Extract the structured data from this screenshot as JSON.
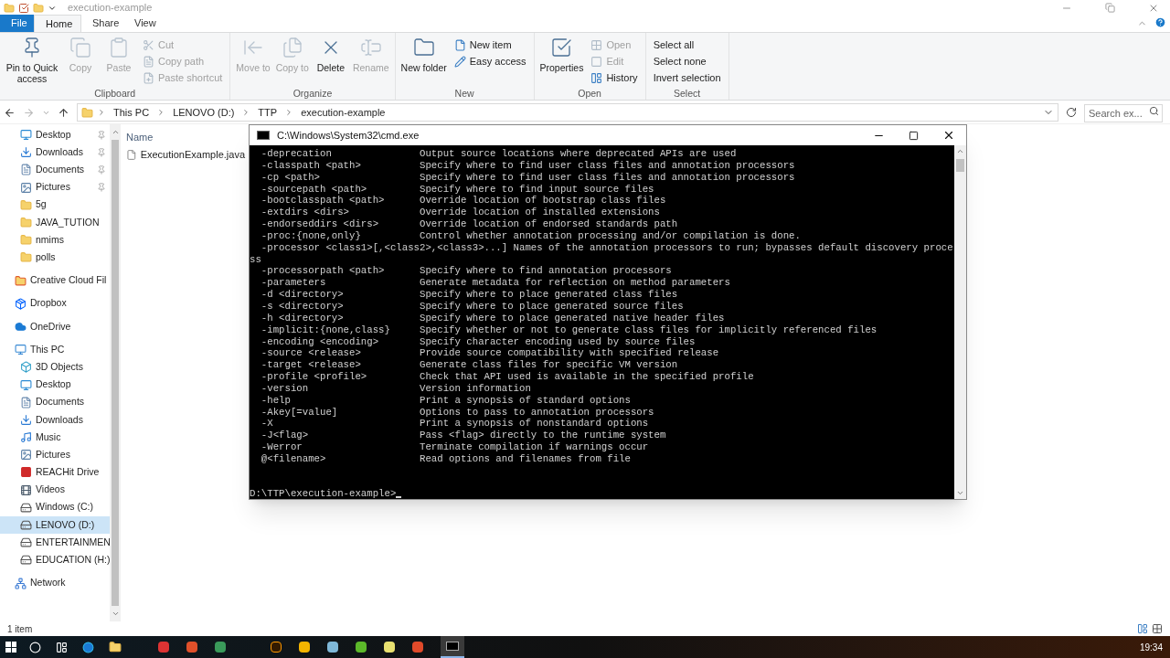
{
  "explorer": {
    "title": "execution-example",
    "tabs": [
      {
        "label": "File",
        "selected": false,
        "kind": "file"
      },
      {
        "label": "Home",
        "selected": true,
        "kind": "tab"
      },
      {
        "label": "Share",
        "selected": false,
        "kind": "tab"
      },
      {
        "label": "View",
        "selected": false,
        "kind": "tab"
      }
    ],
    "ribbon_groups": [
      {
        "label": "Clipboard",
        "items": [
          {
            "label": "Pin to Quick access",
            "kind": "large",
            "disabled": false
          },
          {
            "label": "Copy",
            "kind": "large",
            "disabled": true
          },
          {
            "label": "Paste",
            "kind": "large",
            "disabled": true
          },
          {
            "kind": "stack",
            "items": [
              {
                "label": "Cut",
                "disabled": true
              },
              {
                "label": "Copy path",
                "disabled": true
              },
              {
                "label": "Paste shortcut",
                "disabled": true
              }
            ]
          }
        ]
      },
      {
        "label": "Organize",
        "items": [
          {
            "label": "Move to",
            "kind": "large",
            "disabled": true
          },
          {
            "label": "Copy to",
            "kind": "large",
            "disabled": true
          },
          {
            "label": "Delete",
            "kind": "large",
            "disabled": false
          },
          {
            "label": "Rename",
            "kind": "large",
            "disabled": true
          }
        ]
      },
      {
        "label": "New",
        "items": [
          {
            "label": "New folder",
            "kind": "large",
            "disabled": false
          },
          {
            "kind": "stack",
            "items": [
              {
                "label": "New item",
                "disabled": false
              },
              {
                "label": "Easy access",
                "disabled": false
              }
            ]
          }
        ]
      },
      {
        "label": "Open",
        "items": [
          {
            "label": "Properties",
            "kind": "large",
            "disabled": false
          },
          {
            "kind": "stack",
            "items": [
              {
                "label": "Open",
                "disabled": true
              },
              {
                "label": "Edit",
                "disabled": true
              },
              {
                "label": "History",
                "disabled": false
              }
            ]
          }
        ]
      },
      {
        "label": "Select",
        "items": [
          {
            "kind": "stack",
            "items": [
              {
                "label": "Select all",
                "disabled": false
              },
              {
                "label": "Select none",
                "disabled": false
              },
              {
                "label": "Invert selection",
                "disabled": false
              }
            ]
          }
        ]
      }
    ],
    "breadcrumbs": [
      "This PC",
      "LENOVO (D:)",
      "TTP",
      "execution-example"
    ],
    "search": {
      "placeholder": "Search ex..."
    },
    "quick_access": [
      {
        "label": "Desktop",
        "kind": "desktop",
        "pinned": true,
        "selected": false
      },
      {
        "label": "Downloads",
        "kind": "download",
        "pinned": true,
        "selected": false
      },
      {
        "label": "Documents",
        "kind": "document",
        "pinned": true,
        "selected": false
      },
      {
        "label": "Pictures",
        "kind": "pictures",
        "pinned": true,
        "selected": false
      },
      {
        "label": "5g",
        "kind": "folder",
        "pinned": false,
        "selected": false
      },
      {
        "label": "JAVA_TUTION",
        "kind": "folder",
        "pinned": false,
        "selected": false
      },
      {
        "label": "nmims",
        "kind": "folder",
        "pinned": false,
        "selected": false
      },
      {
        "label": "polls",
        "kind": "folder",
        "pinned": false,
        "selected": false
      }
    ],
    "nav": [
      {
        "label": "Creative Cloud Fil",
        "kind": "creative",
        "selected": false
      },
      {
        "label": "Dropbox",
        "kind": "dropbox",
        "selected": false
      },
      {
        "label": "OneDrive",
        "kind": "cloud",
        "selected": false
      },
      {
        "label": "This PC",
        "kind": "pc",
        "selected": false,
        "children": [
          {
            "label": "3D Objects",
            "kind": "cube",
            "selected": false
          },
          {
            "label": "Desktop",
            "kind": "desktop",
            "selected": false
          },
          {
            "label": "Documents",
            "kind": "document",
            "selected": false
          },
          {
            "label": "Downloads",
            "kind": "download",
            "selected": false
          },
          {
            "label": "Music",
            "kind": "music",
            "selected": false
          },
          {
            "label": "Pictures",
            "kind": "pictures",
            "selected": false
          },
          {
            "label": "REACHit Drive",
            "kind": "reachit",
            "selected": false
          },
          {
            "label": "Videos",
            "kind": "video",
            "selected": false
          },
          {
            "label": "Windows (C:)",
            "kind": "drive",
            "selected": false
          },
          {
            "label": "LENOVO (D:)",
            "kind": "drive",
            "selected": true
          },
          {
            "label": "ENTERTAINMEN",
            "kind": "drive",
            "selected": false
          },
          {
            "label": "EDUCATION (H:)",
            "kind": "drive",
            "selected": false
          }
        ]
      },
      {
        "label": "Network",
        "kind": "network",
        "selected": false
      }
    ],
    "column_header": "Name",
    "files": [
      "ExecutionExample.java"
    ],
    "status": "1 item"
  },
  "cmd": {
    "title": "C:\\Windows\\System32\\cmd.exe",
    "lines": [
      {
        "kind": "option",
        "option": "  -deprecation",
        "description": "Output source locations where deprecated APIs are used"
      },
      {
        "kind": "option",
        "option": "  -classpath <path>",
        "description": "Specify where to find user class files and annotation processors"
      },
      {
        "kind": "option",
        "option": "  -cp <path>",
        "description": "Specify where to find user class files and annotation processors"
      },
      {
        "kind": "option",
        "option": "  -sourcepath <path>",
        "description": "Specify where to find input source files"
      },
      {
        "kind": "option",
        "option": "  -bootclasspath <path>",
        "description": "Override location of bootstrap class files"
      },
      {
        "kind": "option",
        "option": "  -extdirs <dirs>",
        "description": "Override location of installed extensions"
      },
      {
        "kind": "option",
        "option": "  -endorseddirs <dirs>",
        "description": "Override location of endorsed standards path"
      },
      {
        "kind": "option",
        "option": "  -proc:{none,only}",
        "description": "Control whether annotation processing and/or compilation is done."
      },
      {
        "kind": "text",
        "text": "  -processor <class1>[,<class2>,<class3>...] Names of the annotation processors to run; bypasses default discovery proce"
      },
      {
        "kind": "text",
        "text": "ss"
      },
      {
        "kind": "option",
        "option": "  -processorpath <path>",
        "description": "Specify where to find annotation processors"
      },
      {
        "kind": "option",
        "option": "  -parameters",
        "description": "Generate metadata for reflection on method parameters"
      },
      {
        "kind": "option",
        "option": "  -d <directory>",
        "description": "Specify where to place generated class files"
      },
      {
        "kind": "option",
        "option": "  -s <directory>",
        "description": "Specify where to place generated source files"
      },
      {
        "kind": "option",
        "option": "  -h <directory>",
        "description": "Specify where to place generated native header files"
      },
      {
        "kind": "option",
        "option": "  -implicit:{none,class}",
        "description": "Specify whether or not to generate class files for implicitly referenced files"
      },
      {
        "kind": "option",
        "option": "  -encoding <encoding>",
        "description": "Specify character encoding used by source files"
      },
      {
        "kind": "option",
        "option": "  -source <release>",
        "description": "Provide source compatibility with specified release"
      },
      {
        "kind": "option",
        "option": "  -target <release>",
        "description": "Generate class files for specific VM version"
      },
      {
        "kind": "option",
        "option": "  -profile <profile>",
        "description": "Check that API used is available in the specified profile"
      },
      {
        "kind": "option",
        "option": "  -version",
        "description": "Version information"
      },
      {
        "kind": "option",
        "option": "  -help",
        "description": "Print a synopsis of standard options"
      },
      {
        "kind": "option",
        "option": "  -Akey[=value]",
        "description": "Options to pass to annotation processors"
      },
      {
        "kind": "option",
        "option": "  -X",
        "description": "Print a synopsis of nonstandard options"
      },
      {
        "kind": "option",
        "option": "  -J<flag>",
        "description": "Pass <flag> directly to the runtime system"
      },
      {
        "kind": "option",
        "option": "  -Werror",
        "description": "Terminate compilation if warnings occur"
      },
      {
        "kind": "option",
        "option": "  @<filename>",
        "description": "Read options and filenames from file"
      },
      {
        "kind": "blank"
      },
      {
        "kind": "blank"
      }
    ],
    "prompt": "D:\\TTP\\execution-example>"
  },
  "taskbar": {
    "clock": "19:34"
  }
}
